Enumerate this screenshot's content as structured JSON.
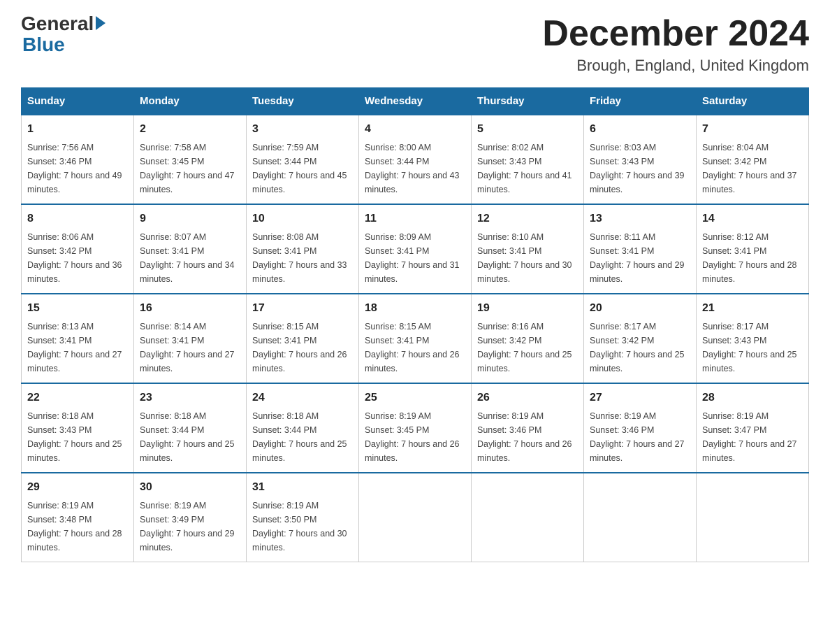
{
  "header": {
    "logo_general": "General",
    "logo_blue": "Blue",
    "month_title": "December 2024",
    "location": "Brough, England, United Kingdom"
  },
  "weekdays": [
    "Sunday",
    "Monday",
    "Tuesday",
    "Wednesday",
    "Thursday",
    "Friday",
    "Saturday"
  ],
  "weeks": [
    [
      {
        "day": "1",
        "sunrise": "7:56 AM",
        "sunset": "3:46 PM",
        "daylight": "7 hours and 49 minutes."
      },
      {
        "day": "2",
        "sunrise": "7:58 AM",
        "sunset": "3:45 PM",
        "daylight": "7 hours and 47 minutes."
      },
      {
        "day": "3",
        "sunrise": "7:59 AM",
        "sunset": "3:44 PM",
        "daylight": "7 hours and 45 minutes."
      },
      {
        "day": "4",
        "sunrise": "8:00 AM",
        "sunset": "3:44 PM",
        "daylight": "7 hours and 43 minutes."
      },
      {
        "day": "5",
        "sunrise": "8:02 AM",
        "sunset": "3:43 PM",
        "daylight": "7 hours and 41 minutes."
      },
      {
        "day": "6",
        "sunrise": "8:03 AM",
        "sunset": "3:43 PM",
        "daylight": "7 hours and 39 minutes."
      },
      {
        "day": "7",
        "sunrise": "8:04 AM",
        "sunset": "3:42 PM",
        "daylight": "7 hours and 37 minutes."
      }
    ],
    [
      {
        "day": "8",
        "sunrise": "8:06 AM",
        "sunset": "3:42 PM",
        "daylight": "7 hours and 36 minutes."
      },
      {
        "day": "9",
        "sunrise": "8:07 AM",
        "sunset": "3:41 PM",
        "daylight": "7 hours and 34 minutes."
      },
      {
        "day": "10",
        "sunrise": "8:08 AM",
        "sunset": "3:41 PM",
        "daylight": "7 hours and 33 minutes."
      },
      {
        "day": "11",
        "sunrise": "8:09 AM",
        "sunset": "3:41 PM",
        "daylight": "7 hours and 31 minutes."
      },
      {
        "day": "12",
        "sunrise": "8:10 AM",
        "sunset": "3:41 PM",
        "daylight": "7 hours and 30 minutes."
      },
      {
        "day": "13",
        "sunrise": "8:11 AM",
        "sunset": "3:41 PM",
        "daylight": "7 hours and 29 minutes."
      },
      {
        "day": "14",
        "sunrise": "8:12 AM",
        "sunset": "3:41 PM",
        "daylight": "7 hours and 28 minutes."
      }
    ],
    [
      {
        "day": "15",
        "sunrise": "8:13 AM",
        "sunset": "3:41 PM",
        "daylight": "7 hours and 27 minutes."
      },
      {
        "day": "16",
        "sunrise": "8:14 AM",
        "sunset": "3:41 PM",
        "daylight": "7 hours and 27 minutes."
      },
      {
        "day": "17",
        "sunrise": "8:15 AM",
        "sunset": "3:41 PM",
        "daylight": "7 hours and 26 minutes."
      },
      {
        "day": "18",
        "sunrise": "8:15 AM",
        "sunset": "3:41 PM",
        "daylight": "7 hours and 26 minutes."
      },
      {
        "day": "19",
        "sunrise": "8:16 AM",
        "sunset": "3:42 PM",
        "daylight": "7 hours and 25 minutes."
      },
      {
        "day": "20",
        "sunrise": "8:17 AM",
        "sunset": "3:42 PM",
        "daylight": "7 hours and 25 minutes."
      },
      {
        "day": "21",
        "sunrise": "8:17 AM",
        "sunset": "3:43 PM",
        "daylight": "7 hours and 25 minutes."
      }
    ],
    [
      {
        "day": "22",
        "sunrise": "8:18 AM",
        "sunset": "3:43 PM",
        "daylight": "7 hours and 25 minutes."
      },
      {
        "day": "23",
        "sunrise": "8:18 AM",
        "sunset": "3:44 PM",
        "daylight": "7 hours and 25 minutes."
      },
      {
        "day": "24",
        "sunrise": "8:18 AM",
        "sunset": "3:44 PM",
        "daylight": "7 hours and 25 minutes."
      },
      {
        "day": "25",
        "sunrise": "8:19 AM",
        "sunset": "3:45 PM",
        "daylight": "7 hours and 26 minutes."
      },
      {
        "day": "26",
        "sunrise": "8:19 AM",
        "sunset": "3:46 PM",
        "daylight": "7 hours and 26 minutes."
      },
      {
        "day": "27",
        "sunrise": "8:19 AM",
        "sunset": "3:46 PM",
        "daylight": "7 hours and 27 minutes."
      },
      {
        "day": "28",
        "sunrise": "8:19 AM",
        "sunset": "3:47 PM",
        "daylight": "7 hours and 27 minutes."
      }
    ],
    [
      {
        "day": "29",
        "sunrise": "8:19 AM",
        "sunset": "3:48 PM",
        "daylight": "7 hours and 28 minutes."
      },
      {
        "day": "30",
        "sunrise": "8:19 AM",
        "sunset": "3:49 PM",
        "daylight": "7 hours and 29 minutes."
      },
      {
        "day": "31",
        "sunrise": "8:19 AM",
        "sunset": "3:50 PM",
        "daylight": "7 hours and 30 minutes."
      },
      null,
      null,
      null,
      null
    ]
  ]
}
